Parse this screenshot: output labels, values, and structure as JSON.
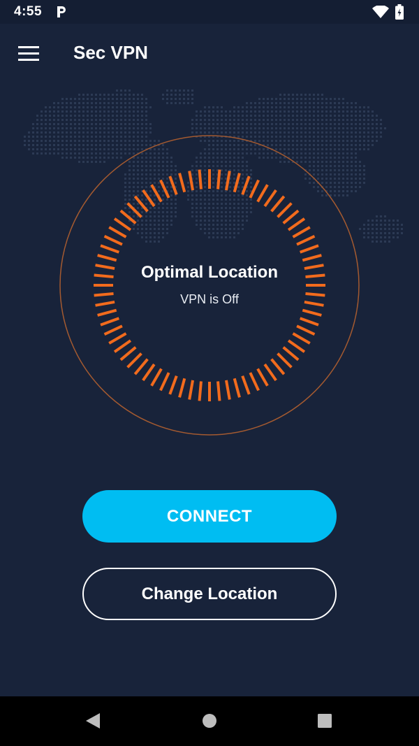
{
  "status_bar": {
    "time": "4:55",
    "icons": [
      "parking-icon",
      "wifi-icon",
      "battery-icon"
    ]
  },
  "app_bar": {
    "title": "Sec VPN",
    "menu_icon": "hamburger-menu-icon"
  },
  "dial": {
    "title": "Optimal Location",
    "status": "VPN is Off",
    "accent_color": "#f26b1d"
  },
  "actions": {
    "connect_label": "CONNECT",
    "change_location_label": "Change Location"
  },
  "colors": {
    "background": "#18233a",
    "status_bar": "#141e33",
    "connect": "#00bdf2",
    "ring": "#a45a30",
    "map_dots": "#2c3a54"
  },
  "nav_bar": {
    "icons": [
      "back-icon",
      "home-icon",
      "recents-icon"
    ]
  }
}
